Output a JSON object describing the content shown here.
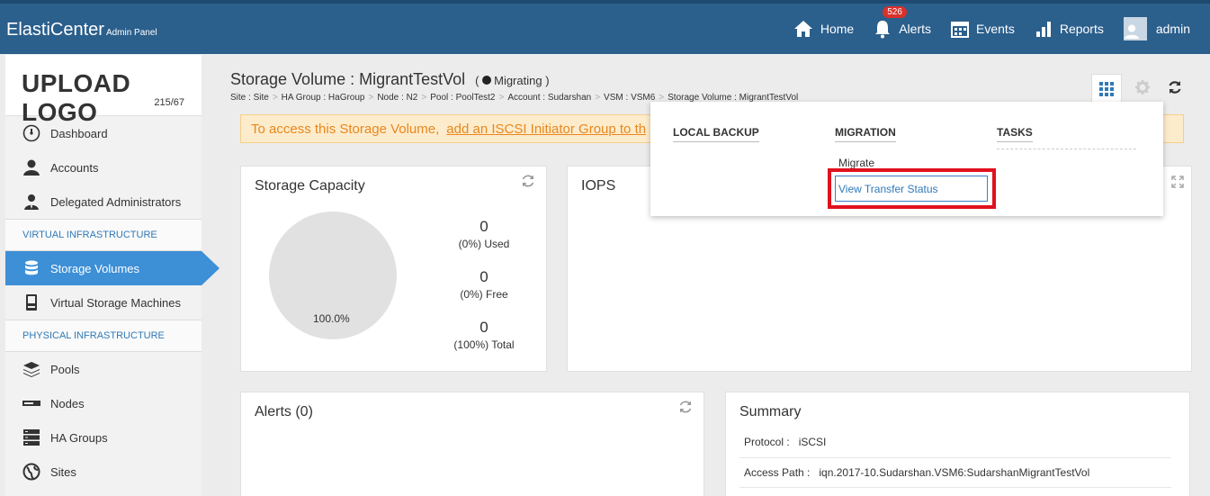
{
  "app": {
    "brand": "ElastiCenter",
    "brand_sub": "Admin Panel"
  },
  "topnav": {
    "home": "Home",
    "alerts": "Alerts",
    "alerts_count": "526",
    "events": "Events",
    "reports": "Reports",
    "user": "admin"
  },
  "sidebar": {
    "logo_text": "UPLOAD LOGO",
    "logo_size": "215/67",
    "items_top": [
      "Dashboard",
      "Accounts",
      "Delegated Administrators"
    ],
    "section_virtual": "VIRTUAL INFRASTRUCTURE",
    "items_virtual": [
      "Storage Volumes",
      "Virtual Storage Machines"
    ],
    "section_physical": "PHYSICAL INFRASTRUCTURE",
    "items_physical": [
      "Pools",
      "Nodes",
      "HA Groups",
      "Sites"
    ]
  },
  "page": {
    "title": "Storage Volume : MigrantTestVol",
    "status": "Migrating",
    "breadcrumb": [
      {
        "label": "Site :",
        "value": "Site"
      },
      {
        "label": "HA Group :",
        "value": "HaGroup"
      },
      {
        "label": "Node :",
        "value": "N2"
      },
      {
        "label": "Pool :",
        "value": "PoolTest2"
      },
      {
        "label": "Account :",
        "value": "Sudarshan"
      },
      {
        "label": "VSM :",
        "value": "VSM6"
      },
      {
        "label": "Storage Volume :",
        "value": "MigrantTestVol"
      }
    ]
  },
  "banner": {
    "text": "To access this Storage Volume,",
    "link": "add an ISCSI Initiator Group to th"
  },
  "capacity": {
    "title": "Storage Capacity",
    "pie_label": "100.0%",
    "used_value": "0",
    "used_label": "(0%) Used",
    "free_value": "0",
    "free_label": "(0%) Free",
    "total_value": "0",
    "total_label": "(100%) Total"
  },
  "iops": {
    "title": "IOPS"
  },
  "alerts_panel": {
    "title": "Alerts (0)"
  },
  "summary": {
    "title": "Summary",
    "protocol_label": "Protocol :",
    "protocol_value": "iSCSI",
    "access_label": "Access Path :",
    "access_value": "iqn.2017-10.Sudarshan.VSM6:SudarshanMigrantTestVol"
  },
  "dropdown": {
    "local_backup": "LOCAL BACKUP",
    "migration": "MIGRATION",
    "tasks": "TASKS",
    "migrate": "Migrate",
    "view_transfer": "View Transfer Status"
  },
  "colors": {
    "topbar": "#2b5f8c",
    "active": "#3d8fd6",
    "banner_text": "#e8871e",
    "highlight": "#e0111e"
  }
}
